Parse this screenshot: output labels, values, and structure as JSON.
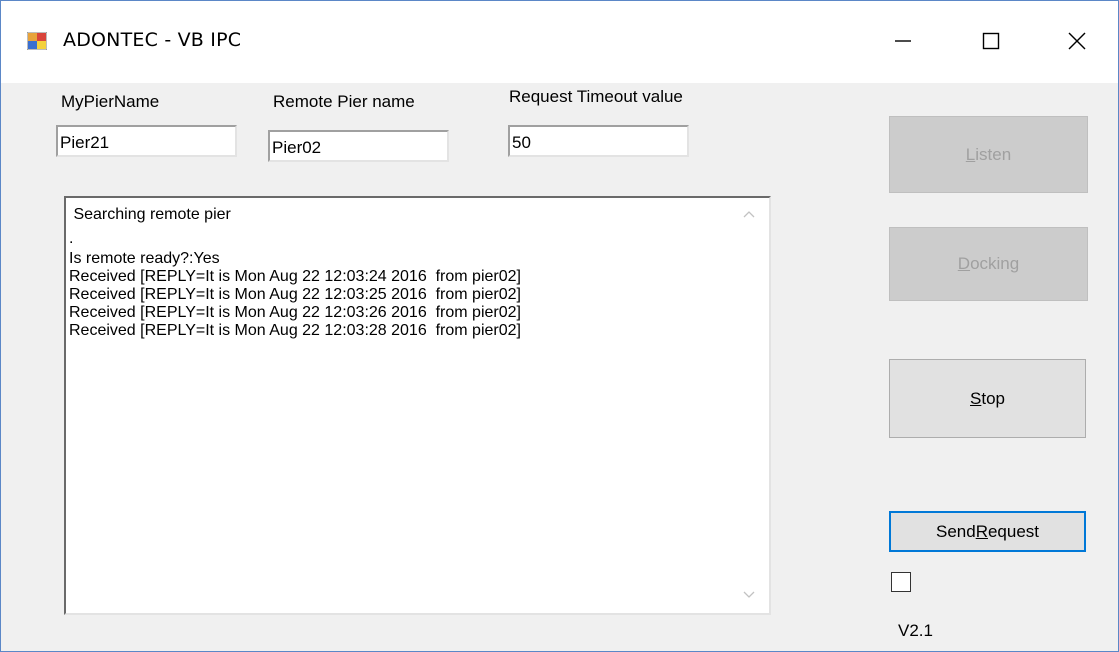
{
  "window": {
    "title": "ADONTEC - VB IPC"
  },
  "fields": {
    "my_pier_label": "MyPierName",
    "my_pier_value": "Pier21",
    "remote_pier_label": "Remote Pier name",
    "remote_pier_value": "Pier02",
    "timeout_label": "Request Timeout value",
    "timeout_value": "50"
  },
  "log": {
    "lines": [
      " Searching remote pier",
      "",
      ".",
      "Is remote ready?:Yes",
      "Received [REPLY=It is Mon Aug 22 12:03:24 2016  from pier02]",
      "Received [REPLY=It is Mon Aug 22 12:03:25 2016  from pier02]",
      "Received [REPLY=It is Mon Aug 22 12:03:26 2016  from pier02]",
      "Received [REPLY=It is Mon Aug 22 12:03:28 2016  from pier02]"
    ]
  },
  "buttons": {
    "listen": {
      "pre": "",
      "accel": "L",
      "post": "isten",
      "enabled": false
    },
    "docking": {
      "pre": "",
      "accel": "D",
      "post": "ocking",
      "enabled": false
    },
    "stop": {
      "pre": "",
      "accel": "S",
      "post": "top",
      "enabled": true
    },
    "send_request": {
      "pre": "Send",
      "accel": "R",
      "post": "equest",
      "enabled": true
    }
  },
  "checkbox": {
    "checked": false
  },
  "version": "V2.1",
  "icons": {
    "app": "app-window-icon",
    "minimize": "minimize-icon",
    "maximize": "maximize-icon",
    "close": "close-icon"
  }
}
